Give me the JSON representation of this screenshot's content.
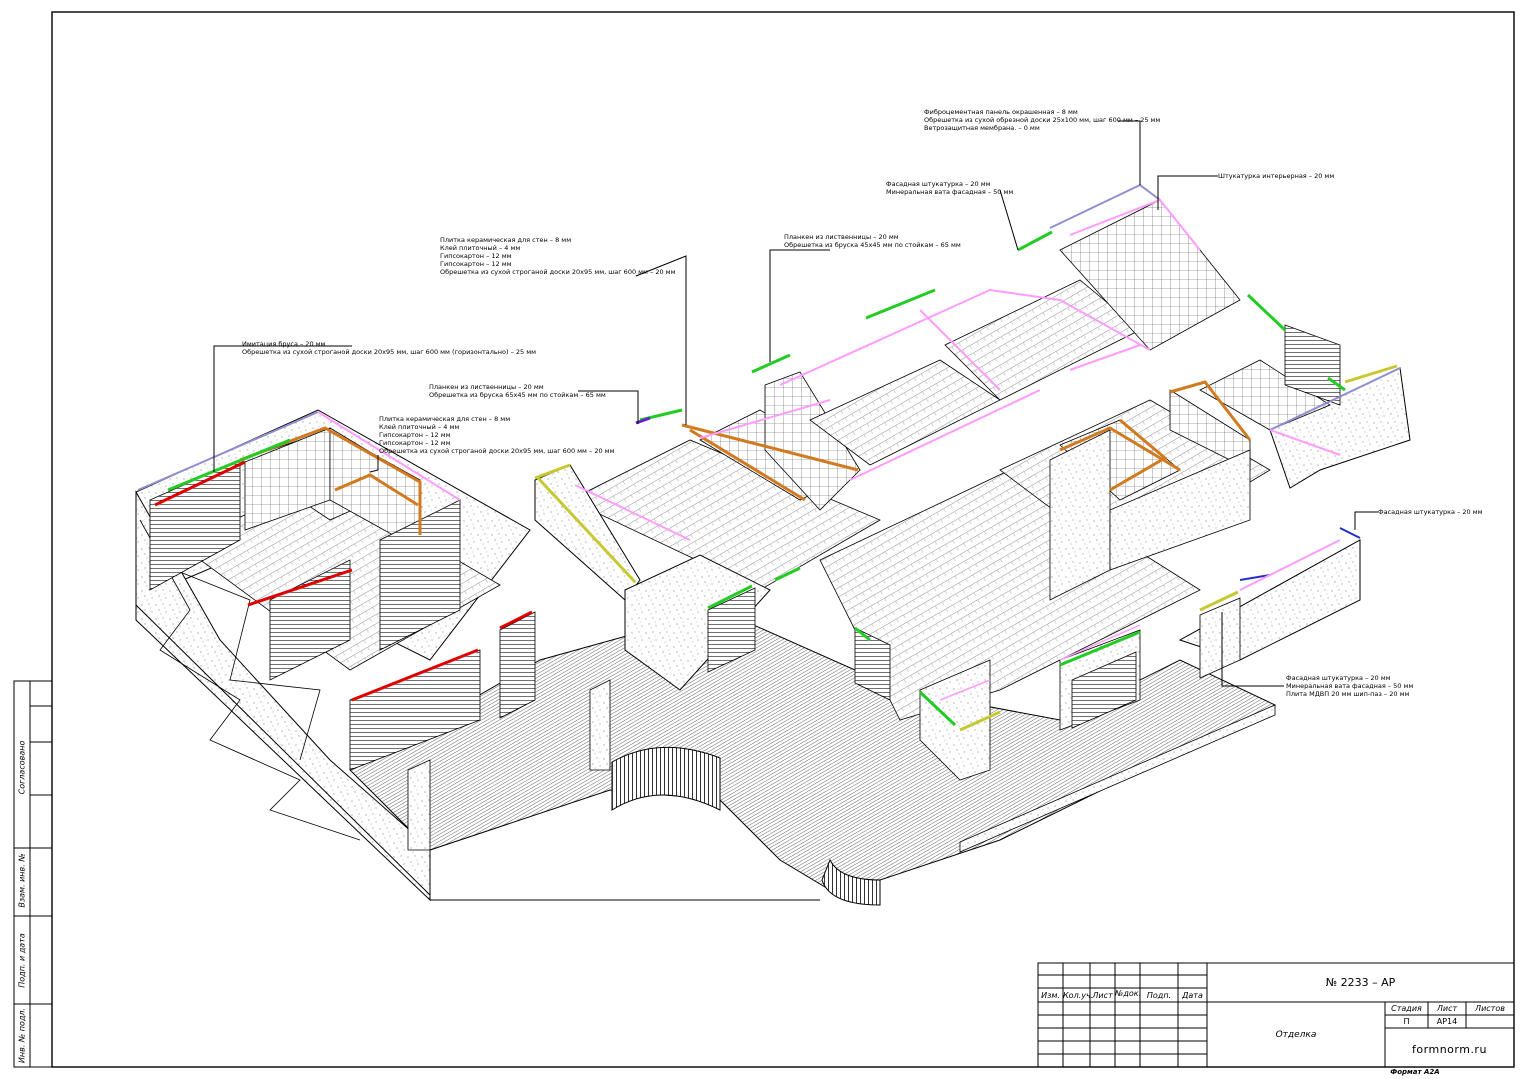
{
  "callouts": [
    {
      "id": "c1",
      "lines": [
        "Фиброцементная панель окрашенная – 8 мм",
        "Обрешетка из сухой обрезной доски 25х100 мм, шаг 600 мм – 25 мм",
        "Ветрозащитная мембрана. – 0 мм"
      ]
    },
    {
      "id": "c2",
      "lines": [
        "Штукатурка интерьерная – 20 мм"
      ]
    },
    {
      "id": "c3",
      "lines": [
        "Фасадная штукатурка – 20 мм",
        "Минеральная вата фасадная – 50 мм"
      ]
    },
    {
      "id": "c4",
      "lines": [
        "Планкен из лиственницы – 20 мм",
        "Обрешетка из бруска 45х45 мм по стойкам – 65 мм"
      ]
    },
    {
      "id": "c5",
      "lines": [
        "Плитка керамическая для стен – 8 мм",
        "Клей плиточный – 4 мм",
        "Гипсокартон – 12 мм",
        "Гипсокартон – 12 мм",
        "Обрешетка из сухой строганой доски 20х95 мм, шаг 600 мм – 20 мм"
      ]
    },
    {
      "id": "c6",
      "lines": [
        "Имитация бруса – 20 мм",
        "Обрешетка из сухой строганой доски 20х95 мм, шаг 600 мм (горизонтально) – 25 мм"
      ]
    },
    {
      "id": "c7",
      "lines": [
        "Планкен из лиственницы – 20 мм",
        "Обрешетка из бруска 65х45 мм по стойкам – 65 мм"
      ]
    },
    {
      "id": "c8",
      "lines": [
        "Плитка керамическая для стен – 8 мм",
        "Клей плиточный – 4 мм",
        "Гипсокартон – 12 мм",
        "Гипсокартон – 12 мм",
        "Обрешетка из сухой строганой доски 20х95 мм, шаг 600 мм – 20 мм"
      ]
    },
    {
      "id": "c9",
      "lines": [
        "Фасадная штукатурка – 20 мм"
      ]
    },
    {
      "id": "c10",
      "lines": [
        "Фасадная штукатурка – 20 мм",
        "Минеральная вата фасадная – 50 мм",
        "Плита МДВП 20 мм шип-паз – 20 мм"
      ]
    }
  ],
  "side_stamp": {
    "agreed": "Согласовано",
    "inv_replaced": "Взам. инв. №",
    "sign_date": "Подп. и дата",
    "inv_original": "Инв. № подл."
  },
  "title_block": {
    "headers": [
      "Изм.",
      "Кол.уч.",
      "Лист",
      "№док.",
      "Подп.",
      "Дата"
    ],
    "doc_number": "№ 2233 – АР",
    "sheet_name": "Отделка",
    "stage_label": "Стадия",
    "sheet_label": "Лист",
    "sheets_label": "Листов",
    "stage_value": "П",
    "sheet_value": "АР14",
    "sheets_value": "",
    "site": "formnorm.ru"
  },
  "format_label": "Формат А2А",
  "colors": {
    "red": "#e00000",
    "orange": "#d27a1f",
    "green": "#22cc22",
    "pink": "#ff9cff",
    "olive": "#c8c832",
    "blue_gray": "#8f8fd0",
    "blue": "#2230c8",
    "purple": "#6a1fd0"
  }
}
